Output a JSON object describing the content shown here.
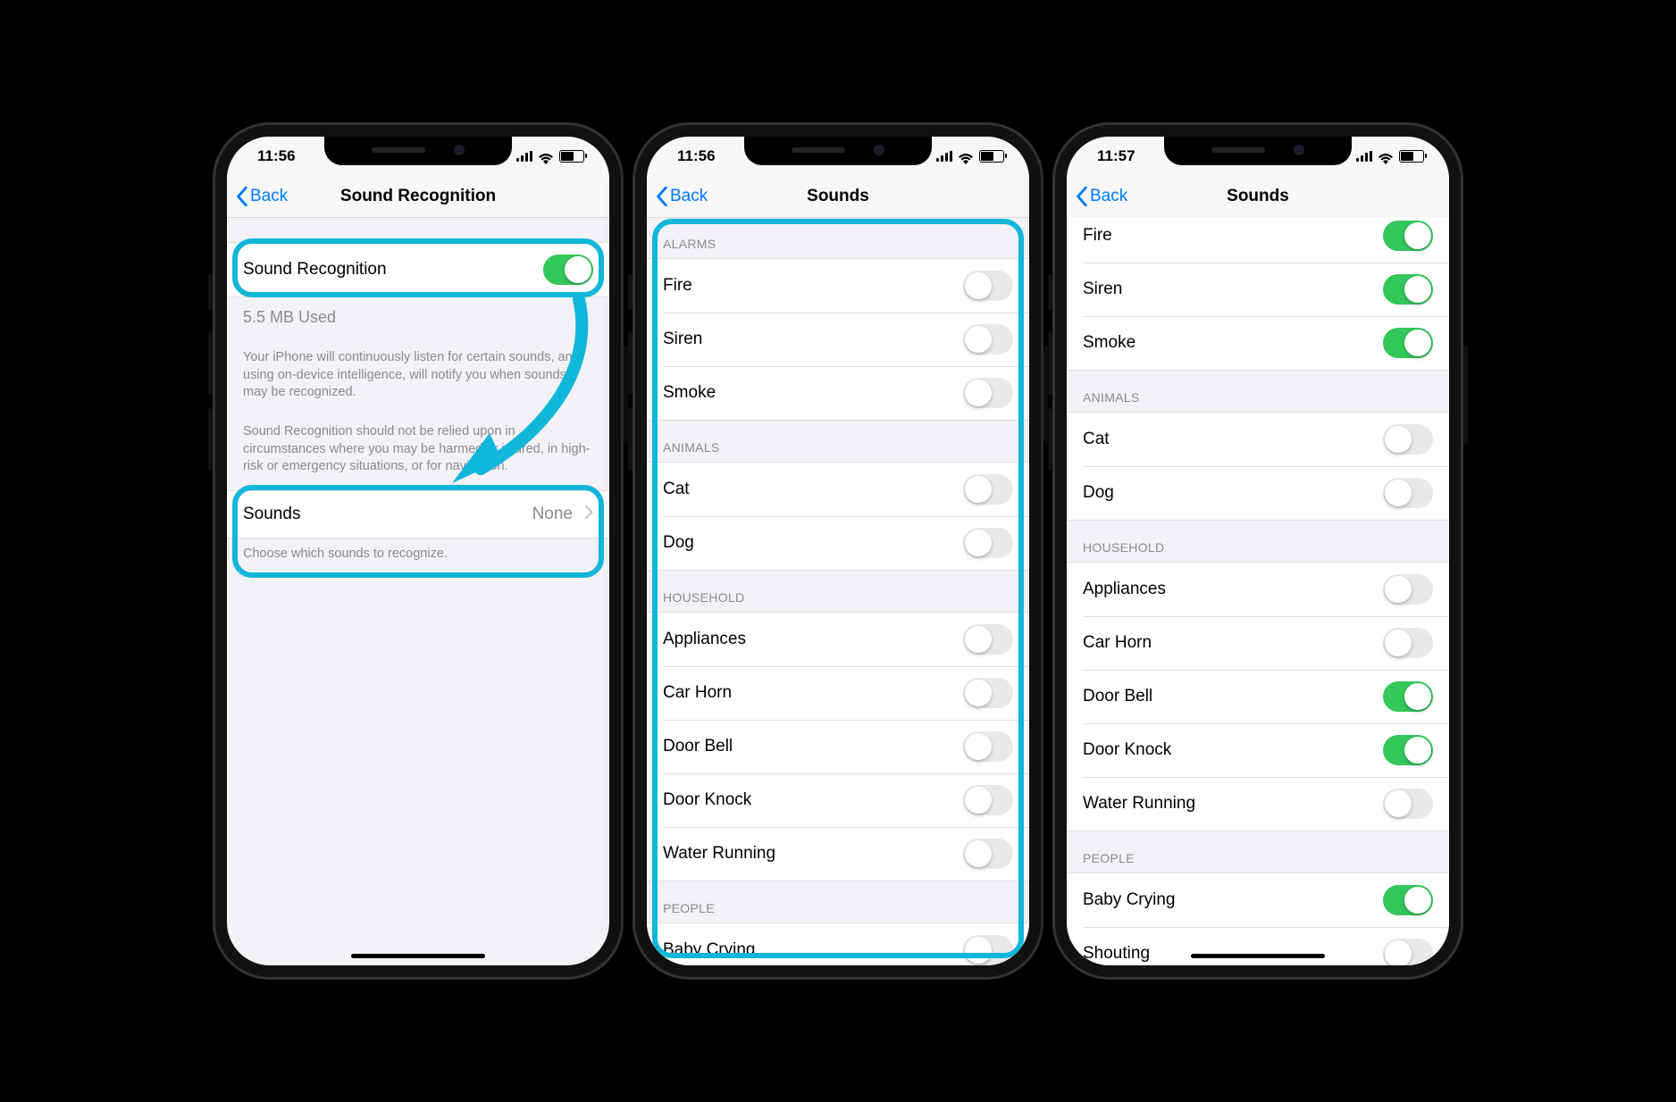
{
  "colors": {
    "accent": "#007aff",
    "switchOn": "#34c759",
    "callout": "#11b7da"
  },
  "statusbar": {
    "time1": "11:56",
    "time2": "11:56",
    "time3": "11:57"
  },
  "nav": {
    "back": "Back",
    "title1": "Sound Recognition",
    "title2": "Sounds",
    "title3": "Sounds"
  },
  "phone1": {
    "mainToggle": {
      "label": "Sound Recognition",
      "on": true
    },
    "storage": "5.5 MB Used",
    "desc1": "Your iPhone will continuously listen for certain sounds, and using on-device intelligence, will notify you when sounds may be recognized.",
    "desc2": "Sound Recognition should not be relied upon in circumstances where you may be harmed or injured, in high-risk or emergency situations, or for navigation.",
    "soundsRow": {
      "label": "Sounds",
      "value": "None"
    },
    "soundsFooter": "Choose which sounds to recognize."
  },
  "g_alarms": "Alarms",
  "g_animals": "Animals",
  "g_household": "Household",
  "g_people": "People",
  "sounds": {
    "fire": "Fire",
    "siren": "Siren",
    "smoke": "Smoke",
    "cat": "Cat",
    "dog": "Dog",
    "appliances": "Appliances",
    "carhorn": "Car Horn",
    "doorbell": "Door Bell",
    "doorknock": "Door Knock",
    "water": "Water Running",
    "baby": "Baby Crying",
    "shouting": "Shouting"
  },
  "phone2_states": {
    "fire": false,
    "siren": false,
    "smoke": false,
    "cat": false,
    "dog": false,
    "appliances": false,
    "carhorn": false,
    "doorbell": false,
    "doorknock": false,
    "water": false,
    "baby": false
  },
  "phone3_states": {
    "fire": true,
    "siren": true,
    "smoke": true,
    "cat": false,
    "dog": false,
    "appliances": false,
    "carhorn": false,
    "doorbell": true,
    "doorknock": true,
    "water": false,
    "baby": true,
    "shouting": false
  }
}
